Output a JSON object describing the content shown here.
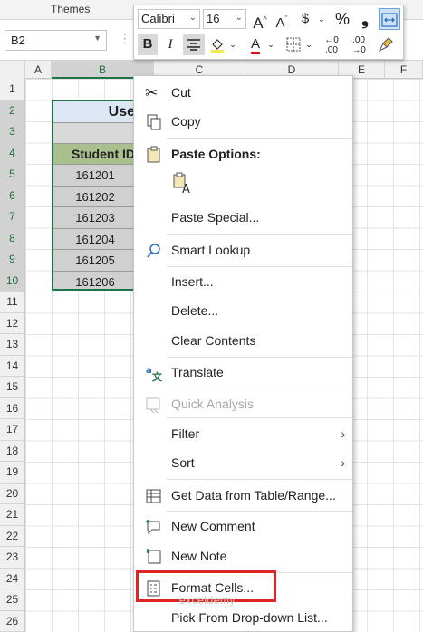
{
  "ribbon": {
    "themes_label": "Themes"
  },
  "name_box": {
    "value": "B2"
  },
  "columns": [
    "A",
    "B",
    "C",
    "D",
    "E",
    "F"
  ],
  "rows": [
    "1",
    "2",
    "3",
    "4",
    "5",
    "6",
    "7",
    "8",
    "9",
    "10",
    "11",
    "12",
    "13",
    "14",
    "15",
    "16",
    "17",
    "18",
    "19",
    "20",
    "21",
    "22",
    "23",
    "24",
    "25",
    "26"
  ],
  "table": {
    "title": "Use",
    "header": "Student ID",
    "values": [
      "161201",
      "161202",
      "161203",
      "161204",
      "161205",
      "161206"
    ]
  },
  "mini_toolbar": {
    "font_name": "Calibri",
    "font_size": "16",
    "grow_label": "A^",
    "shrink_label": "Aˇ",
    "currency": "$",
    "percent": "%",
    "comma": "❟",
    "bold": "B",
    "italic": "I",
    "font_color": "A",
    "inc_decimal": "←0\n.00",
    "dec_decimal": ".00\n→0"
  },
  "context_menu": {
    "items": [
      {
        "label": "Cut",
        "icon": "scissors-icon",
        "enabled": true
      },
      {
        "label": "Copy",
        "icon": "copy-icon",
        "enabled": true
      },
      {
        "label": "Paste Options:",
        "icon": "paste-icon",
        "enabled": true
      },
      {
        "label": "Paste Special...",
        "icon": "",
        "enabled": true
      },
      {
        "label": "Smart Lookup",
        "icon": "smart-lookup-icon",
        "enabled": true
      },
      {
        "label": "Insert...",
        "icon": "",
        "enabled": true
      },
      {
        "label": "Delete...",
        "icon": "",
        "enabled": true
      },
      {
        "label": "Clear Contents",
        "icon": "",
        "enabled": true
      },
      {
        "label": "Translate",
        "icon": "translate-icon",
        "enabled": true
      },
      {
        "label": "Quick Analysis",
        "icon": "quick-analysis-icon",
        "enabled": false
      },
      {
        "label": "Filter",
        "icon": "",
        "enabled": true,
        "submenu": true
      },
      {
        "label": "Sort",
        "icon": "",
        "enabled": true,
        "submenu": true
      },
      {
        "label": "Get Data from Table/Range...",
        "icon": "table-range-icon",
        "enabled": true
      },
      {
        "label": "New Comment",
        "icon": "new-comment-icon",
        "enabled": true
      },
      {
        "label": "New Note",
        "icon": "new-note-icon",
        "enabled": true
      },
      {
        "label": "Format Cells...",
        "icon": "format-cells-icon",
        "enabled": true
      },
      {
        "label": "Pick From Drop-down List...",
        "icon": "",
        "enabled": true
      }
    ]
  },
  "watermark": "exceldemy",
  "colors": {
    "accent_green": "#217346",
    "highlight_red": "#e02424",
    "title_fill": "#dce6f5",
    "header_fill": "#a9c08e",
    "value_fill": "#d0d0d0"
  }
}
